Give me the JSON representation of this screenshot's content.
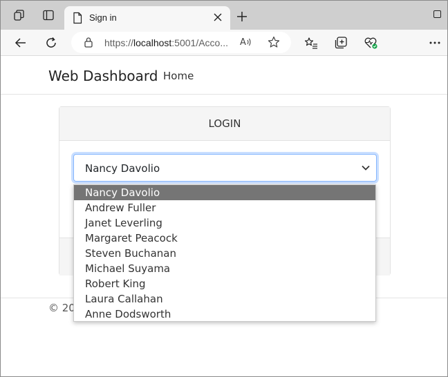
{
  "browser": {
    "tab_title": "Sign in",
    "url_prefix": "https://",
    "url_host": "localhost",
    "url_rest": ":5001/Acco..."
  },
  "page": {
    "brand": "Web Dashboard",
    "nav": {
      "home": "Home"
    },
    "card": {
      "header": "LOGIN"
    },
    "select": {
      "value": "Nancy Davolio"
    },
    "footer_text": "© 20"
  },
  "dropdown": {
    "options": [
      "Nancy Davolio",
      "Andrew Fuller",
      "Janet Leverling",
      "Margaret Peacock",
      "Steven Buchanan",
      "Michael Suyama",
      "Robert King",
      "Laura Callahan",
      "Anne Dodsworth"
    ],
    "selected_index": 0
  },
  "colors": {
    "selected_option_bg": "#757575",
    "focus_ring": "#86b7fe",
    "heart_badge": "#16a34a"
  },
  "icons": {
    "workspaces": "workspaces-icon",
    "tab_actions": "tab-actions-icon",
    "page": "page-icon",
    "back": "back-arrow-icon",
    "refresh": "refresh-icon",
    "lock": "lock-icon",
    "read_aloud": "read-aloud-icon",
    "favorite": "star-icon",
    "favorites": "favorites-list-icon",
    "collections": "collections-icon",
    "health": "browser-essentials-icon",
    "more": "more-icon"
  }
}
